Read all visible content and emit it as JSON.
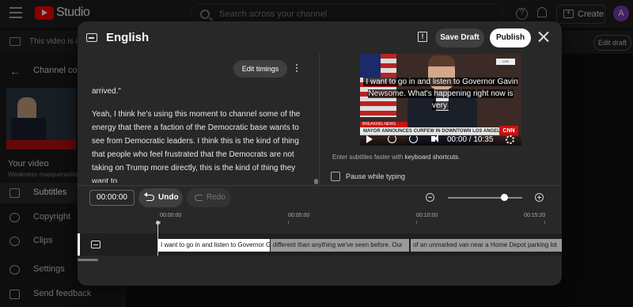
{
  "app": {
    "logo_text": "Studio",
    "search_placeholder": "Search across your channel",
    "help_glyph": "?",
    "create_label": "Create",
    "create_glyph": "+",
    "avatar_letter": "A",
    "brand_color": "#ff0000",
    "avatar_color": "#7b3fb5"
  },
  "notice": {
    "text": "This video is in a",
    "edit_draft_label": "Edit draft"
  },
  "sidebar": {
    "back_glyph": "←",
    "channel_label": "Channel cont",
    "your_video_label": "Your video",
    "video_title": "Weakness masquerading",
    "items": [
      {
        "label": "Subtitles",
        "icon": "subtitles-icon",
        "active": true
      },
      {
        "label": "Copyright",
        "icon": "copyright-icon",
        "active": false
      },
      {
        "label": "Clips",
        "icon": "clips-icon",
        "active": false
      },
      {
        "label": "Settings",
        "icon": "settings-icon",
        "active": false
      },
      {
        "label": "Send feedback",
        "icon": "feedback-icon",
        "active": false
      }
    ]
  },
  "editor": {
    "language": "English",
    "feedback_glyph": "!",
    "save_draft_label": "Save Draft",
    "publish_label": "Publish",
    "edit_timings_label": "Edit timings",
    "transcript": [
      "arrived.\"",
      "Yeah, I think he's using this moment to channel some of the energy that there a faction of the Democratic base wants to see from Democratic leaders. I think this is the kind of thing that people who feel frustrated that the Democrats are not taking on Trump more directly, this is the kind of thing they want to"
    ],
    "video": {
      "caption": "I want to go in and listen to Governor Gavin Newsome. What's happening right now is very",
      "la_badge": "LOS ANGELES",
      "breaking": "BREAKING NEWS",
      "lower_third": "MAYOR ANNOUNCES CURFEW IN DOWNTOWN LOS ANGELES",
      "network": "CNN",
      "time": "00:00 / 10:35"
    },
    "hint_prefix": "Enter subtitles faster with ",
    "hint_link": "keyboard shortcuts",
    "hint_suffix": ".",
    "pause_label": "Pause while typing",
    "pause_checked": false
  },
  "toolbar": {
    "current_time": "00:00:00",
    "undo_label": "Undo",
    "redo_label": "Redo",
    "zoom_level": 0.75
  },
  "timeline": {
    "ticks": [
      "00:00:00",
      "00:05:00",
      "00:10:00",
      "00:15:20"
    ],
    "segments": [
      {
        "text": "I want to go in and listen to Governor Gavin Newsome.",
        "active": true
      },
      {
        "text": "different than anything we've seen before. Our",
        "active": false
      },
      {
        "text": "of an unmarked van near a Home Depot parking lot",
        "active": false
      }
    ]
  }
}
